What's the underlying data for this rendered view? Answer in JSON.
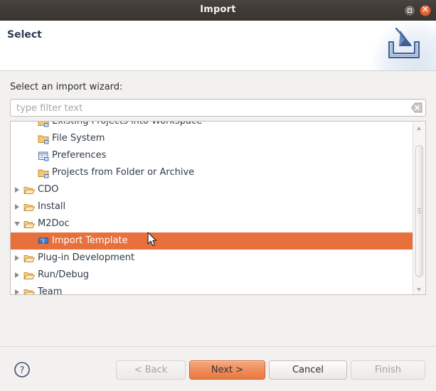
{
  "window": {
    "title": "Import",
    "restore_label": "Restore",
    "close_label": "Close"
  },
  "header": {
    "title": "Select",
    "banner_icon": "import-banner-icon"
  },
  "body": {
    "wizard_label": "Select an import wizard:"
  },
  "filter": {
    "value": "",
    "placeholder": "type filter text",
    "clear_icon": "clear-icon"
  },
  "tree": {
    "items": [
      {
        "label": "Existing Projects into Workspace",
        "level": "leaf",
        "icon": "folder-import-icon",
        "selected": false,
        "expandable": false
      },
      {
        "label": "File System",
        "level": "leaf",
        "icon": "folder-import-icon",
        "selected": false,
        "expandable": false
      },
      {
        "label": "Preferences",
        "level": "leaf",
        "icon": "preferences-icon",
        "selected": false,
        "expandable": false
      },
      {
        "label": "Projects from Folder or Archive",
        "level": "leaf",
        "icon": "folder-import-icon",
        "selected": false,
        "expandable": false
      },
      {
        "label": "CDO",
        "level": "category",
        "icon": "open-folder-icon",
        "selected": false,
        "expandable": true,
        "expanded": false
      },
      {
        "label": "Install",
        "level": "category",
        "icon": "open-folder-icon",
        "selected": false,
        "expandable": true,
        "expanded": false
      },
      {
        "label": "M2Doc",
        "level": "category",
        "icon": "open-folder-icon",
        "selected": false,
        "expandable": true,
        "expanded": true
      },
      {
        "label": "Import Template",
        "level": "leaf",
        "icon": "template-book-icon",
        "selected": true,
        "expandable": false
      },
      {
        "label": "Plug-in Development",
        "level": "category",
        "icon": "open-folder-icon",
        "selected": false,
        "expandable": true,
        "expanded": false
      },
      {
        "label": "Run/Debug",
        "level": "category",
        "icon": "open-folder-icon",
        "selected": false,
        "expandable": true,
        "expanded": false
      },
      {
        "label": "Team",
        "level": "category",
        "icon": "open-folder-icon",
        "selected": false,
        "expandable": true,
        "expanded": false
      }
    ]
  },
  "scrollbar": {
    "up_icon": "scroll-up-arrow-icon",
    "down_icon": "scroll-down-arrow-icon"
  },
  "footer": {
    "help_icon": "help-question-icon",
    "back_label": "< Back",
    "next_label": "Next >",
    "cancel_label": "Cancel",
    "finish_label": "Finish"
  },
  "colors": {
    "selection": "#e8703c",
    "primary_button": "#e8793f",
    "titlebar": "#3f3a36",
    "close_button": "#e2623a",
    "dialog_background": "#f2f1f0"
  }
}
